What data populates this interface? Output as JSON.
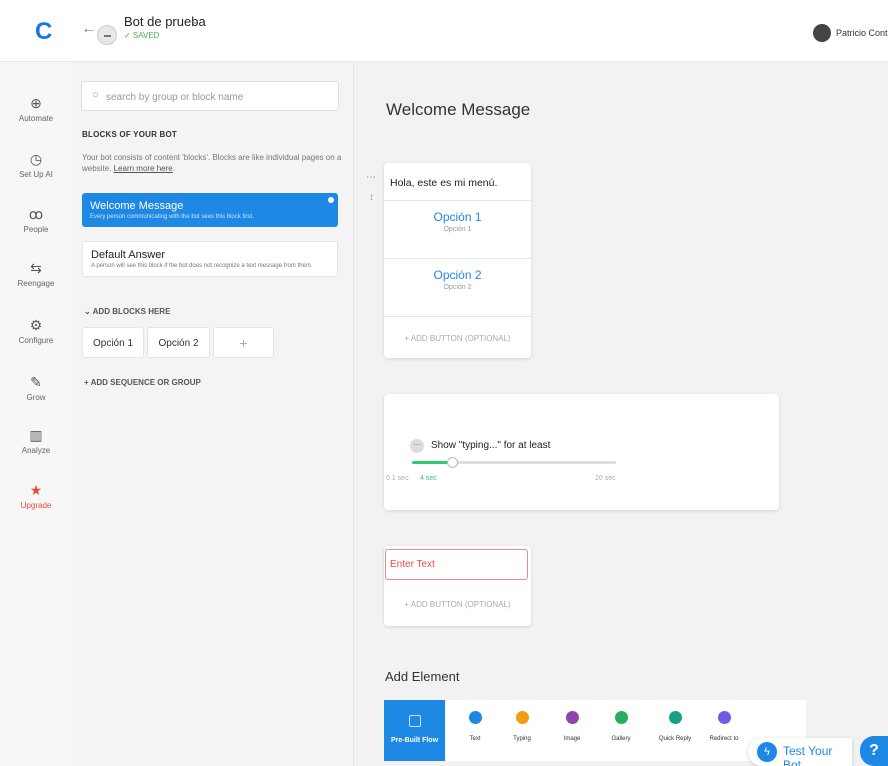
{
  "topbar": {
    "logo": "C",
    "bot_name": "Bot de prueba",
    "bot_status": "✓ SAVED",
    "user_name": "Patricio Contreras"
  },
  "nav": {
    "items": [
      {
        "label": "Automate",
        "icon": "grid-globe-icon"
      },
      {
        "label": "Set Up AI",
        "icon": "robot-icon"
      },
      {
        "label": "People",
        "icon": "people-icon"
      },
      {
        "label": "Reengage",
        "icon": "arrows-icon"
      },
      {
        "label": "Configure",
        "icon": "gear-icon"
      },
      {
        "label": "Grow",
        "icon": "pencil-icon"
      },
      {
        "label": "Analyze",
        "icon": "bar-chart-icon"
      },
      {
        "label": "Upgrade",
        "icon": "star-icon"
      }
    ]
  },
  "panel": {
    "search_placeholder": "search by group or block name",
    "section_title": "BLOCKS OF YOUR BOT",
    "description": "Your bot consists of content 'blocks'. Blocks are like individual pages on a website.",
    "learn_more": "Learn more here",
    "blocks": [
      {
        "name": "Welcome Message",
        "sub": "Every person communicating with the bot sees this block first."
      },
      {
        "name": "Default Answer",
        "sub": "A person will see this block if the bot does not recognize a text message from them."
      }
    ],
    "add_blocks_label": "ADD BLOCKS HERE",
    "chips": [
      "Opción 1",
      "Opción 2",
      "+"
    ],
    "add_sequence_label": "ADD SEQUENCE OR GROUP"
  },
  "editor": {
    "title": "Welcome Message",
    "message_text": "Hola, este es mi menú.",
    "options": [
      {
        "label": "Opción 1",
        "sub": "Opción 1"
      },
      {
        "label": "Opción 2",
        "sub": "Opción 2"
      }
    ],
    "add_button_label": "+ ADD BUTTON (OPTIONAL)",
    "typing": {
      "label": "Show \"typing...\" for at least",
      "min": "0.1 sec",
      "current": "4 sec",
      "max": "20 sec",
      "value_seconds": 4,
      "range_seconds": [
        0.1,
        20
      ]
    },
    "text_placeholder": "Enter Text",
    "add_button_label_2": "+ ADD BUTTON (OPTIONAL)",
    "add_element_title": "Add Element",
    "prebuilt_label": "Pre-Built Flow",
    "elements": [
      {
        "label": "Text",
        "color": "#1e88e5"
      },
      {
        "label": "Typing",
        "color": "#f39c12"
      },
      {
        "label": "Image",
        "color": "#8e44ad"
      },
      {
        "label": "Gallery",
        "color": "#27ae60"
      },
      {
        "label": "Quick Reply",
        "color": "#16a085"
      },
      {
        "label": "Redirect to",
        "color": "#6c5ce7"
      }
    ],
    "test_bot_label": "Test Your Bot",
    "help_label": "?"
  },
  "colors": {
    "accent": "#1e88e5",
    "success": "#2ecc71",
    "danger": "#e74c3c"
  }
}
